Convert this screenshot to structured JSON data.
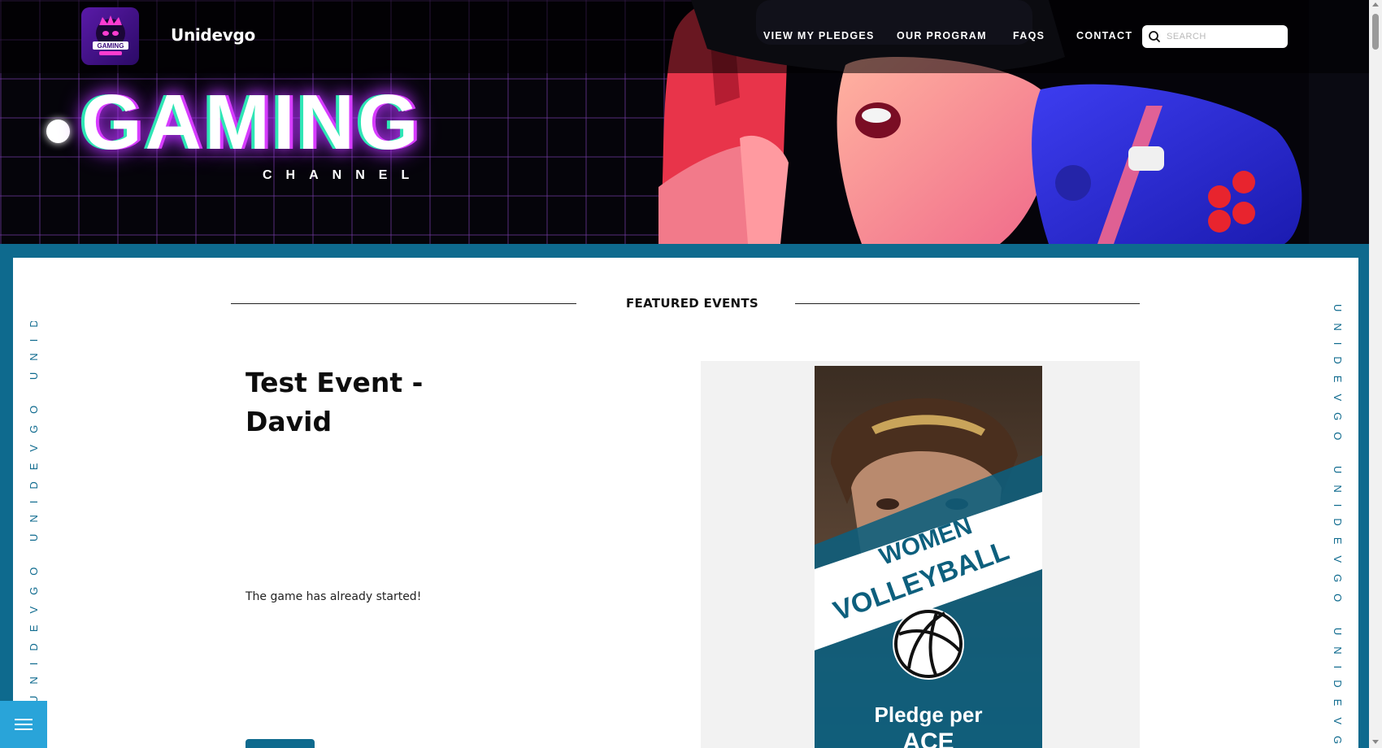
{
  "header": {
    "brand": "Unidevgo",
    "logo_text": "GAMING",
    "nav": [
      {
        "label": "VIEW MY PLEDGES"
      },
      {
        "label": "OUR PROGRAM"
      },
      {
        "label": "FAQS"
      },
      {
        "label": "CONTACT"
      }
    ],
    "search": {
      "placeholder": "SEARCH",
      "icon": "search-icon"
    }
  },
  "hero": {
    "title": "GAMING",
    "subtitle": "CHANNEL"
  },
  "side_text": {
    "left": "UNIDEVGO UNIDEVGO UNIDEVGO",
    "right": "UNIDEVGO UNIDEVGO UNIDEVGO"
  },
  "featured": {
    "heading": "FEATURED EVENTS",
    "event": {
      "title": "Test Event - David",
      "description": "The game has already started!"
    },
    "poster": {
      "line1": "WOMEN",
      "line2": "VOLLEYBALL",
      "line3": "Pledge per",
      "line4": "ACE"
    }
  },
  "menu_button": {
    "icon": "hamburger-icon"
  },
  "colors": {
    "frame_blue": "#0e6a8e",
    "fab_blue": "#29a4d9",
    "neon_pink": "#d73cff",
    "neon_teal": "#2ee6b5"
  }
}
